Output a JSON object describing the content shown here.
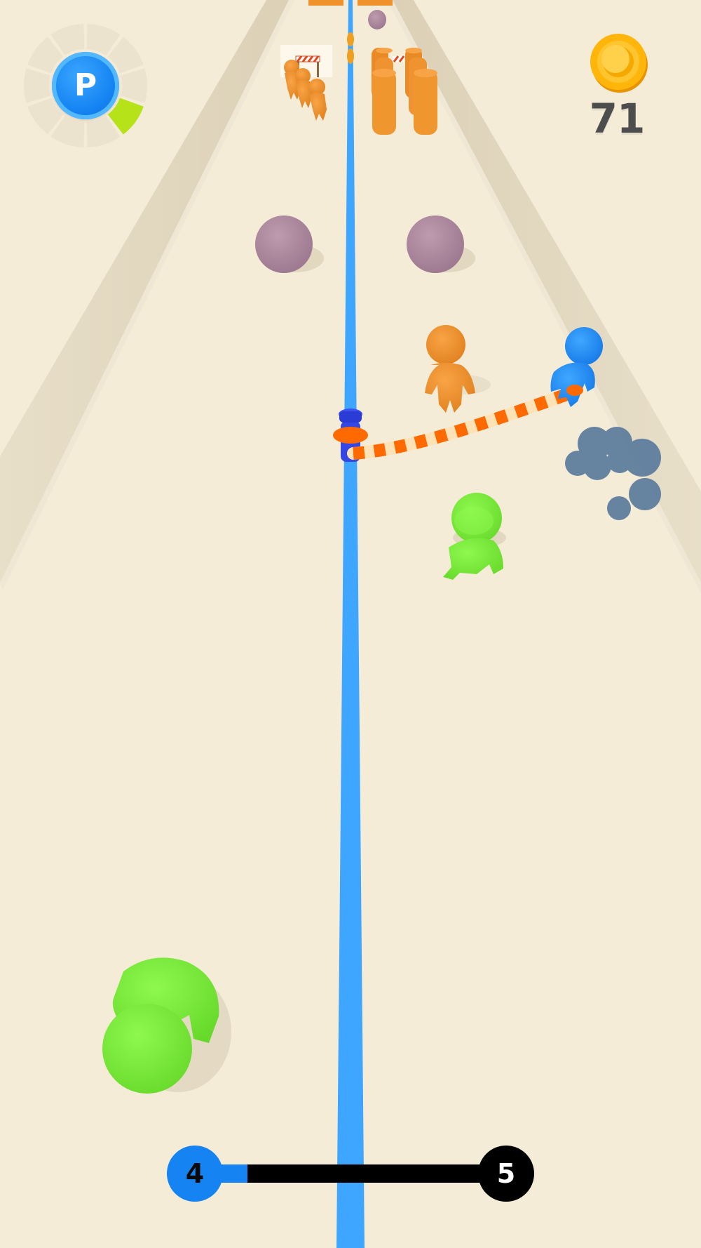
{
  "hud": {
    "perk": {
      "letter": "P",
      "icon": "perk-p-icon",
      "meter_segments": 10,
      "meter_filled_segments": 1,
      "meter_filled_color": "#b6e21a",
      "meter_empty_color": "#ece3cf"
    },
    "coins": {
      "count": "71",
      "icon": "gold-coin-icon",
      "color": "#ffb50a"
    },
    "level": {
      "current": "4",
      "next": "5",
      "progress": 0.17,
      "fill_color": "#1583f2",
      "track_color": "#000000"
    }
  },
  "colors": {
    "ground": "#f5ecd8",
    "wall": "#e2d8c0",
    "lane_line": "#3ea6ff",
    "enemy": "#f0922b",
    "player": "#1a8cf7",
    "green_crowd": "#7ef03d",
    "boulder": "#b08a9e",
    "smoke": "#5f7f9e",
    "rope_stripe_a": "#ff6a00",
    "rope_stripe_b": "#ffe2b5"
  }
}
